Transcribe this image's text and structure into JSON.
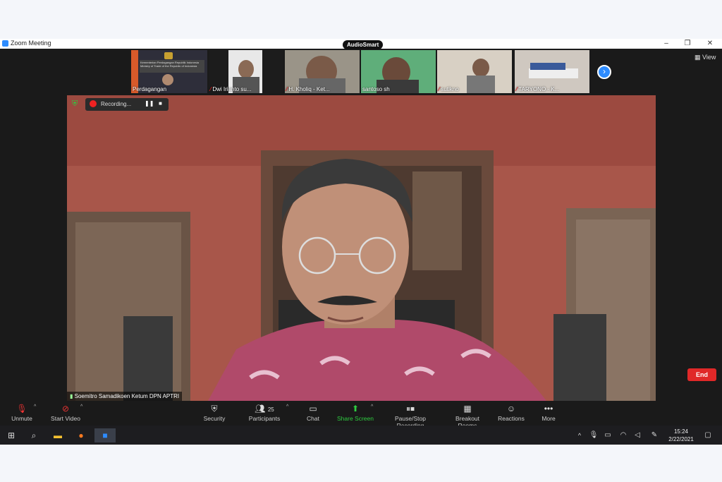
{
  "window": {
    "title": "Zoom Meeting",
    "badge": "AudioSmart"
  },
  "participants_strip": [
    {
      "name": "Perdagangan",
      "muted": false
    },
    {
      "name": "Dwi Irianto su...",
      "muted": true
    },
    {
      "name": "H. Kholiq - Ket...",
      "muted": true
    },
    {
      "name": "santoso sh",
      "muted": false
    },
    {
      "name": "sutikno",
      "muted": true
    },
    {
      "name": "TARYONO - K...",
      "muted": true
    }
  ],
  "view_label": "View",
  "recording": {
    "label": "Recording..."
  },
  "active_speaker": {
    "name": "Soemitro Samadikoen Ketum DPN APTRI"
  },
  "toolbar": {
    "unmute": "Unmute",
    "start_video": "Start Video",
    "security": "Security",
    "participants": "Participants",
    "participants_count": "25",
    "chat": "Chat",
    "share_screen": "Share Screen",
    "pause_stop_recording": "Pause/Stop Recording",
    "breakout_rooms": "Breakout Rooms",
    "reactions": "Reactions",
    "more": "More",
    "end": "End"
  },
  "taskbar": {
    "time": "15:24",
    "date": "2/22/2021"
  },
  "colors": {
    "share_green": "#2ecc40",
    "end_red": "#e02828",
    "zoom_blue": "#2d8cff"
  }
}
